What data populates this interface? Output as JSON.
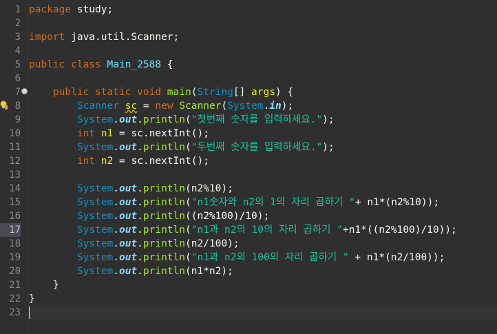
{
  "editor": {
    "line_numbers": [
      "1",
      "2",
      "3",
      "4",
      "5",
      "6",
      "7",
      "8",
      "9",
      "10",
      "11",
      "12",
      "13",
      "14",
      "15",
      "16",
      "17",
      "18",
      "19",
      "20",
      "21",
      "22",
      "23"
    ],
    "active_line": "17",
    "code": {
      "l1": {
        "kw": "package",
        "rest": " study;"
      },
      "l3": {
        "kw": "import",
        "rest": " java.util.Scanner;"
      },
      "l5": {
        "kw": "public class",
        "name": "Main_2588",
        "rest": " {"
      },
      "l7": {
        "mods": "public static void",
        "method": "main",
        "p1": "(",
        "type": "String",
        "p2": "[] ",
        "arg": "args",
        "p3": ") {"
      },
      "l8": {
        "type": "Scanner",
        "var": "sc",
        "eq": " = ",
        "kw": "new",
        "mth": "Scanner",
        "p1": "(",
        "sys": "System",
        "dot": ".",
        "fld": "in",
        "p2": ");"
      },
      "l9": {
        "sys": "System",
        "fld": "out",
        "mth": "println",
        "str": "\"첫번째 숫자를 입력하세요.\"",
        "end": ");"
      },
      "l10": {
        "kw": "int",
        "var": "n1",
        "rest": " = sc.nextInt();"
      },
      "l11": {
        "sys": "System",
        "fld": "out",
        "mth": "println",
        "str": "\"두번째 숫자를 입력하세요.\"",
        "end": ");"
      },
      "l12": {
        "kw": "int",
        "var": "n2",
        "rest": " = sc.nextInt();"
      },
      "l14": {
        "sys": "System",
        "fld": "out",
        "mth": "println",
        "args": "(n2%10);"
      },
      "l15": {
        "sys": "System",
        "fld": "out",
        "mth": "println",
        "str": "\"n1숫자와 n2의 1의 자리 곱하기 \"",
        "end": "+ n1*(n2%10));"
      },
      "l16": {
        "sys": "System",
        "fld": "out",
        "mth": "println",
        "args": "((n2%100)/10);"
      },
      "l17": {
        "sys": "System",
        "fld": "out",
        "mth": "println",
        "str": "\"n1과 n2의 10의 자리 곱하기 \"",
        "end": "+n1*((n2%100)/10));"
      },
      "l18": {
        "sys": "System",
        "fld": "out",
        "mth": "println",
        "args": "(n2/100);"
      },
      "l19": {
        "sys": "System",
        "fld": "out",
        "mth": "println",
        "str": "\"n1과 n2의 100의 자리 곱하기 \"",
        "end": " + n1*(n2/100));"
      },
      "l20": {
        "sys": "System",
        "fld": "out",
        "mth": "println",
        "args": "(n1*n2);"
      },
      "l21": {
        "rest": "}"
      },
      "l22": {
        "rest": "}"
      }
    }
  }
}
